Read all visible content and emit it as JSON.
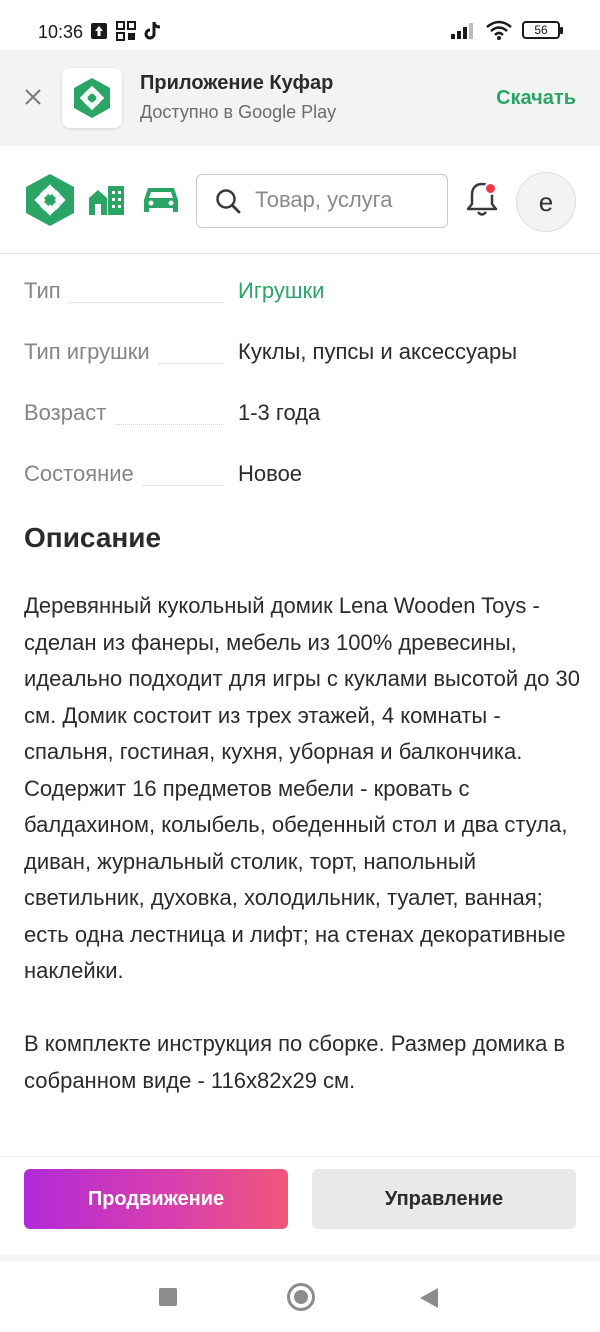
{
  "status_bar": {
    "time": "10:36",
    "battery": "56"
  },
  "banner": {
    "title": "Приложение Куфар",
    "subtitle": "Доступно в Google Play",
    "download_label": "Скачать",
    "close_icon": "close-icon"
  },
  "header": {
    "search_placeholder": "Товар, услуга",
    "avatar_letter": "е",
    "icons": [
      "kufar-logo-icon",
      "realty-icon",
      "car-icon",
      "search-icon",
      "bell-icon"
    ]
  },
  "params": [
    {
      "label": "Тип",
      "value": "Игрушки",
      "link": true
    },
    {
      "label": "Тип игрушки",
      "value": "Куклы, пупсы и аксессуары",
      "link": false
    },
    {
      "label": "Возраст",
      "value": "1-3 года",
      "link": false
    },
    {
      "label": "Состояние",
      "value": "Новое",
      "link": false
    }
  ],
  "description": {
    "title": "Описание",
    "text": "Деревянный кукольный домик Lena Wooden Toys - сделан из фанеры, мебель из 100% древесины, идеально подходит для игры с куклами высотой до 30 см. Домик состоит из трех этажей, 4 комнаты - спальня, гостиная, кухня, уборная и балкончика.\nСодержит 16 предметов мебели - кровать с балдахином, колыбель, обеденный стол и два стула, диван, журнальный столик, торт, напольный светильник, духовка, холодильник, туалет, ванная; есть одна лестница и лифт; на стенах декоративные наклейки.\n\nВ комплекте инструкция по сборке. Размер домика в собранном виде - 116x82x29 см."
  },
  "actions": {
    "promo_label": "Продвижение",
    "manage_label": "Управление"
  },
  "colors": {
    "brand_green": "#2ba565",
    "link_green": "#2ba565",
    "notification_red": "#ef3b49"
  }
}
